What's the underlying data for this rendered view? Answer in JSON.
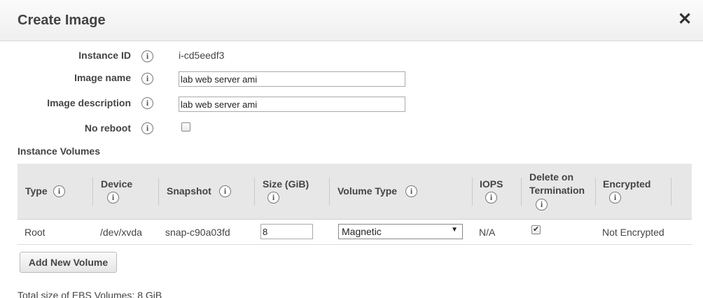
{
  "dialog": {
    "title": "Create Image",
    "close_glyph": "✕"
  },
  "form": {
    "instance_id_label": "Instance ID",
    "instance_id_value": "i-cd5eedf3",
    "image_name_label": "Image name",
    "image_name_value": "lab web server ami",
    "image_description_label": "Image description",
    "image_description_value": "lab web server ami",
    "no_reboot_label": "No reboot",
    "no_reboot_checked": false
  },
  "info_glyph": "i",
  "volumes": {
    "section_title": "Instance Volumes",
    "columns": {
      "type": "Type",
      "device": "Device",
      "snapshot": "Snapshot",
      "size": "Size (GiB)",
      "volume_type": "Volume Type",
      "iops": "IOPS",
      "delete_line1": "Delete on",
      "delete_line2": "Termination",
      "encrypted": "Encrypted"
    },
    "rows": [
      {
        "type": "Root",
        "device": "/dev/xvda",
        "snapshot": "snap-c90a03fd",
        "size": "8",
        "volume_type": "Magnetic",
        "iops": "N/A",
        "delete_on_termination": true,
        "encrypted": "Not Encrypted"
      }
    ]
  },
  "add_volume_button": "Add New Volume",
  "total_size_text": "Total size of EBS Volumes: 8 GiB"
}
